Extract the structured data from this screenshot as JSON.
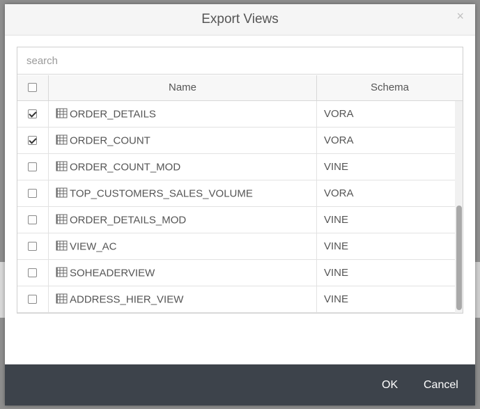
{
  "dialog": {
    "title": "Export Views",
    "close_glyph": "×"
  },
  "search": {
    "value": "",
    "placeholder": "search"
  },
  "columns": {
    "name": "Name",
    "schema": "Schema"
  },
  "rows": [
    {
      "name": "ORDER_DETAILS",
      "schema": "VORA",
      "checked": true
    },
    {
      "name": "ORDER_COUNT",
      "schema": "VORA",
      "checked": true
    },
    {
      "name": "ORDER_COUNT_MOD",
      "schema": "VINE",
      "checked": false
    },
    {
      "name": "TOP_CUSTOMERS_SALES_VOLUME",
      "schema": "VORA",
      "checked": false
    },
    {
      "name": "ORDER_DETAILS_MOD",
      "schema": "VINE",
      "checked": false
    },
    {
      "name": "VIEW_AC",
      "schema": "VINE",
      "checked": false
    },
    {
      "name": "SOHEADERVIEW",
      "schema": "VINE",
      "checked": false
    },
    {
      "name": "ADDRESS_HIER_VIEW",
      "schema": "VINE",
      "checked": false
    }
  ],
  "footer": {
    "ok_label": "OK",
    "cancel_label": "Cancel"
  },
  "icons": {
    "row_icon": "table-view-icon",
    "close": "close-icon"
  },
  "colors": {
    "footer_bg": "#3d434b",
    "header_bg": "#f5f5f5",
    "text": "#555555"
  }
}
